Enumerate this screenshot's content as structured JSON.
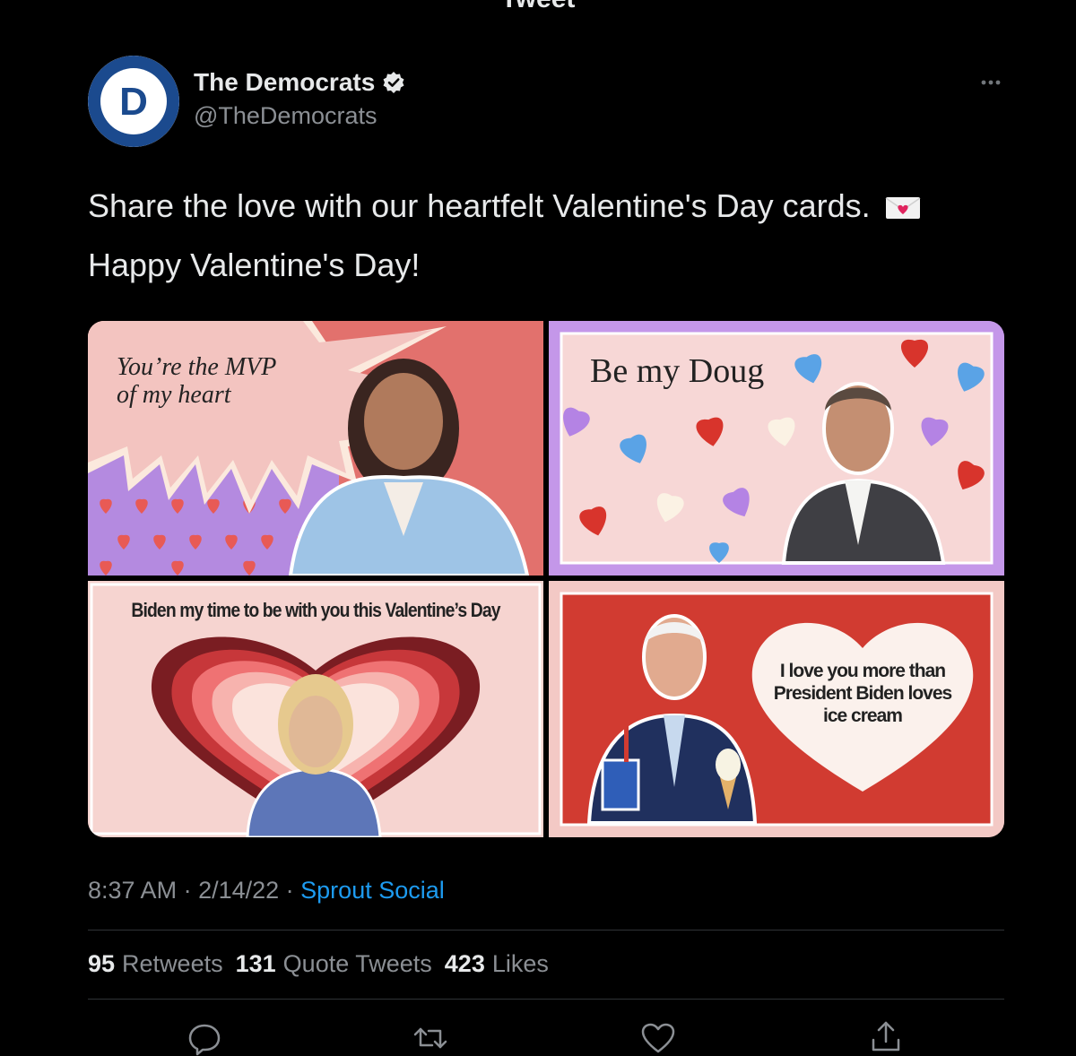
{
  "header": {
    "title": "Tweet"
  },
  "author": {
    "name": "The Democrats",
    "handle": "@TheDemocrats",
    "avatar_letter": "D",
    "verified": true
  },
  "tweet": {
    "line1": "Share the love with our heartfelt Valentine's Day cards.",
    "line2": "Happy Valentine's Day!",
    "emoji_icon": "love-letter-icon"
  },
  "cards": {
    "card1_line1": "You’re the MVP",
    "card1_line2": "of my heart",
    "card2_text": "Be my Doug",
    "card3_text": "Biden my time to be with you this Valentine’s Day",
    "card4_line1": "I love you more than",
    "card4_line2": "President Biden loves",
    "card4_line3": "ice cream"
  },
  "meta": {
    "time": "8:37 AM",
    "sep1": " · ",
    "date": "2/14/22",
    "sep2": " · ",
    "source": "Sprout Social"
  },
  "stats": {
    "retweets_count": "95",
    "retweets_label": "Retweets",
    "quotes_count": "131",
    "quotes_label": "Quote Tweets",
    "likes_count": "423",
    "likes_label": "Likes"
  },
  "actions": [
    "reply-icon",
    "retweet-icon",
    "like-icon",
    "share-icon"
  ],
  "colors": {
    "accent": "#1d9bf0",
    "background": "#000000",
    "muted": "#8b8f94"
  }
}
